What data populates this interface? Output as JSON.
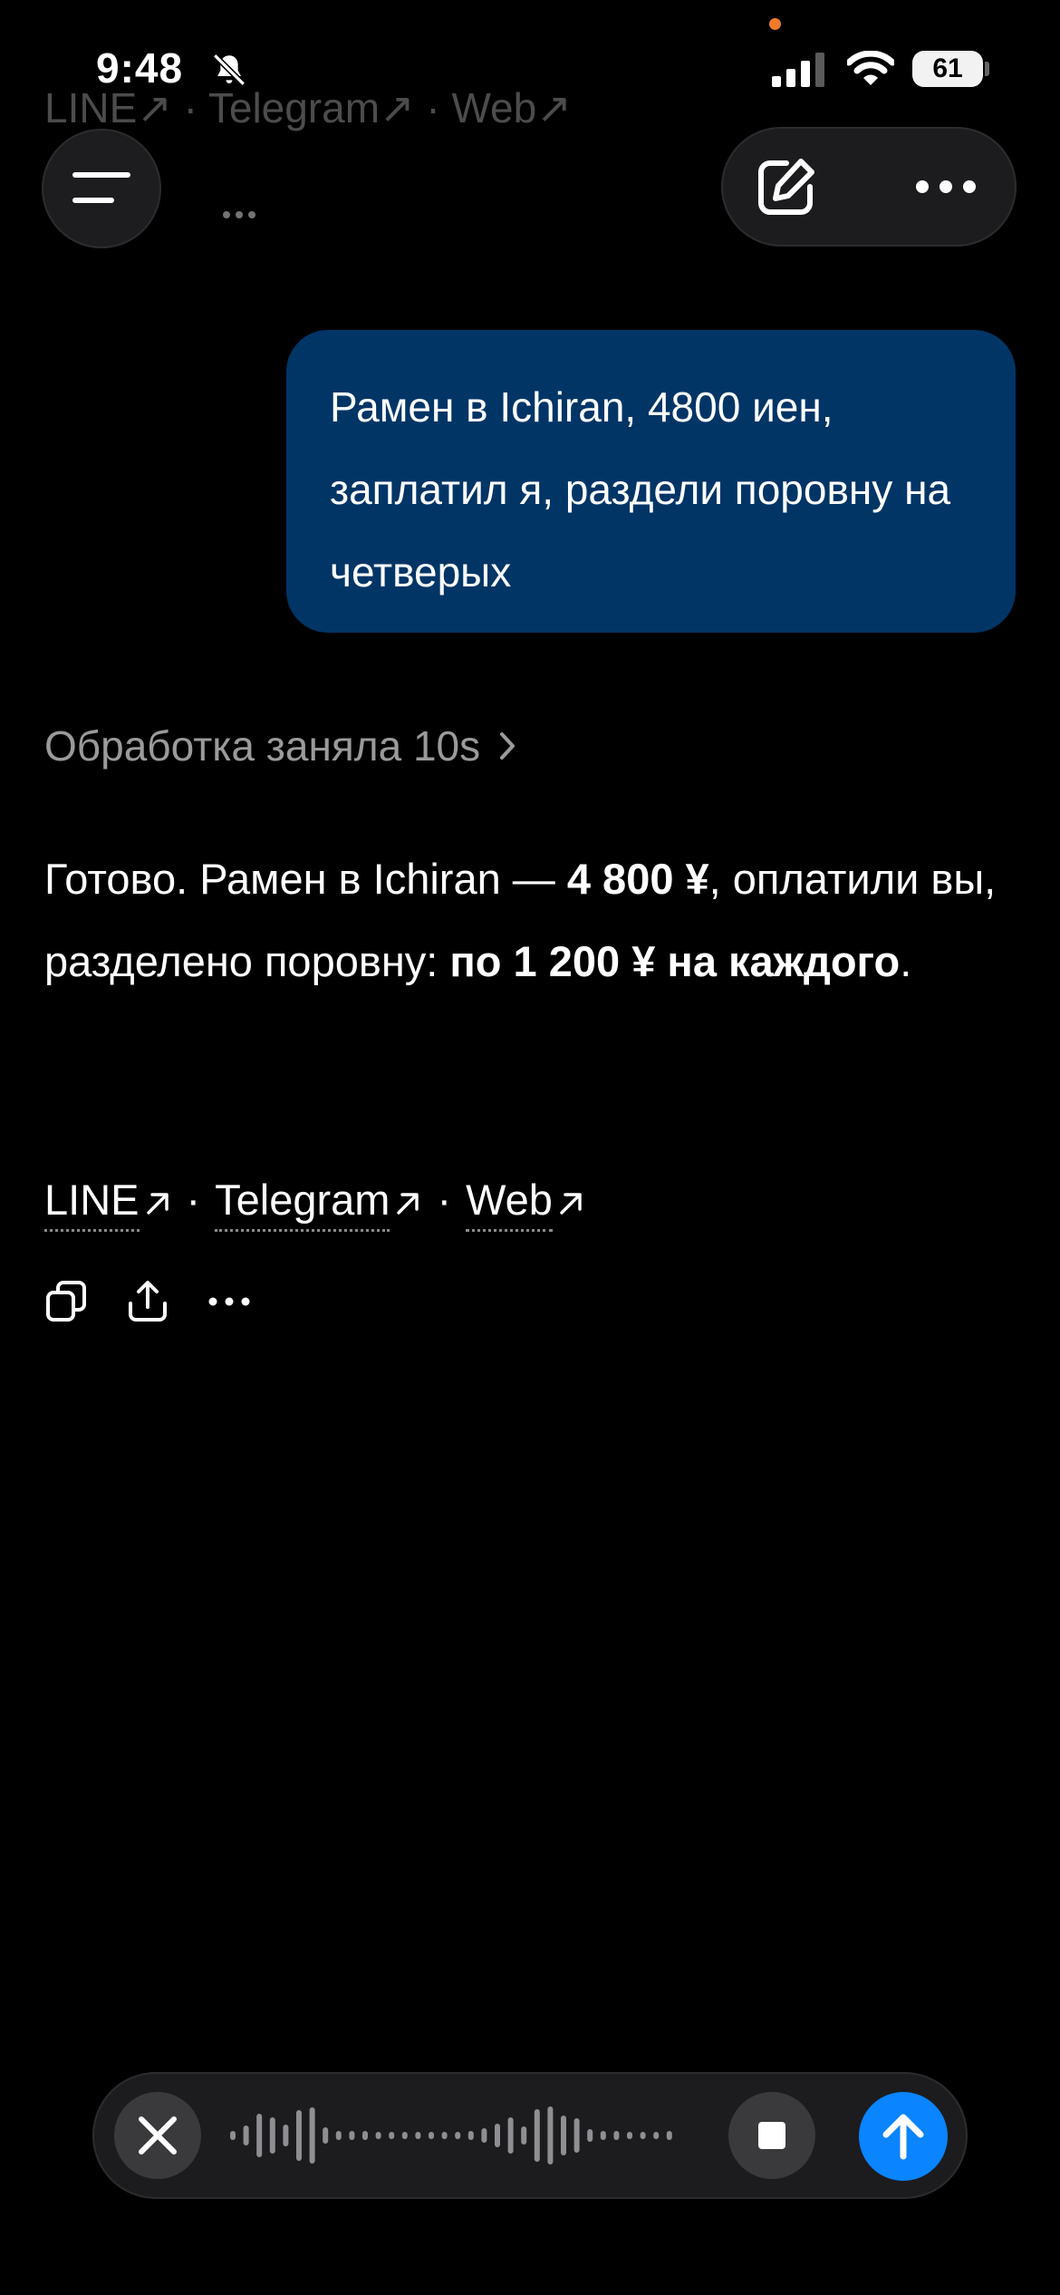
{
  "status_bar": {
    "time": "9:48",
    "battery": "61"
  },
  "faded": {
    "link_line": "LINE↗ · Telegram↗ · Web↗"
  },
  "conversation": {
    "user_message": "Рамен в Ichiran, 4800 иен, заплатил я, раздели поровну на четверых",
    "processing_label": "Обработка заняла 10s",
    "reply": {
      "p1": "Готово. Рамен в Ichiran — ",
      "b1": "4 800 ¥",
      "p2": ", оплатили вы, разделено поровну: ",
      "b2": "по 1 200 ¥ на каждого",
      "p3": "."
    },
    "links": [
      "LINE",
      "Telegram",
      "Web"
    ],
    "separator": "·"
  },
  "icons": {
    "menu": "menu-icon",
    "edit": "edit-icon",
    "more": "more-icon",
    "copy": "copy-icon",
    "share": "share-icon",
    "close": "close-icon",
    "stop": "stop-icon",
    "send": "send-arrow-icon"
  },
  "colors": {
    "bubble": "#003566",
    "send": "#0a84ff",
    "background": "#000000"
  }
}
